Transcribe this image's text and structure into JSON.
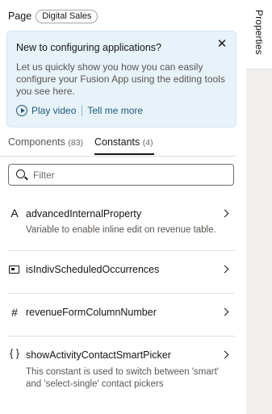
{
  "page": {
    "label": "Page",
    "badge": "Digital Sales"
  },
  "rail": {
    "tab_label": "Properties"
  },
  "info": {
    "title": "New to configuring applications?",
    "body": "Let us quickly show you how you can easily configure your Fusion App using the editing tools you see here.",
    "play_video": "Play video",
    "tell_me_more": "Tell me more",
    "close_icon": "close-icon"
  },
  "tabs": [
    {
      "label": "Components",
      "count": "(83)",
      "active": false
    },
    {
      "label": "Constants",
      "count": "(4)",
      "active": true
    }
  ],
  "filter": {
    "placeholder": "Filter",
    "value": ""
  },
  "constants": [
    {
      "icon": "text-icon",
      "glyph": "A",
      "name": "advancedInternalProperty",
      "description": "Variable to enable inline edit on revenue table."
    },
    {
      "icon": "boolean-icon",
      "glyph": "",
      "name": "isIndivScheduledOccurrences",
      "description": ""
    },
    {
      "icon": "number-icon",
      "glyph": "#",
      "name": "revenueFormColumnNumber",
      "description": ""
    },
    {
      "icon": "object-icon",
      "glyph": "{ }",
      "name": "showActivityContactSmartPicker",
      "description": "This constant is used to switch between 'smart' and 'select-single' contact pickers"
    }
  ],
  "colors": {
    "info_bg": "#e7f2f9",
    "link": "#205b79",
    "rail_bg": "#f1efed"
  }
}
